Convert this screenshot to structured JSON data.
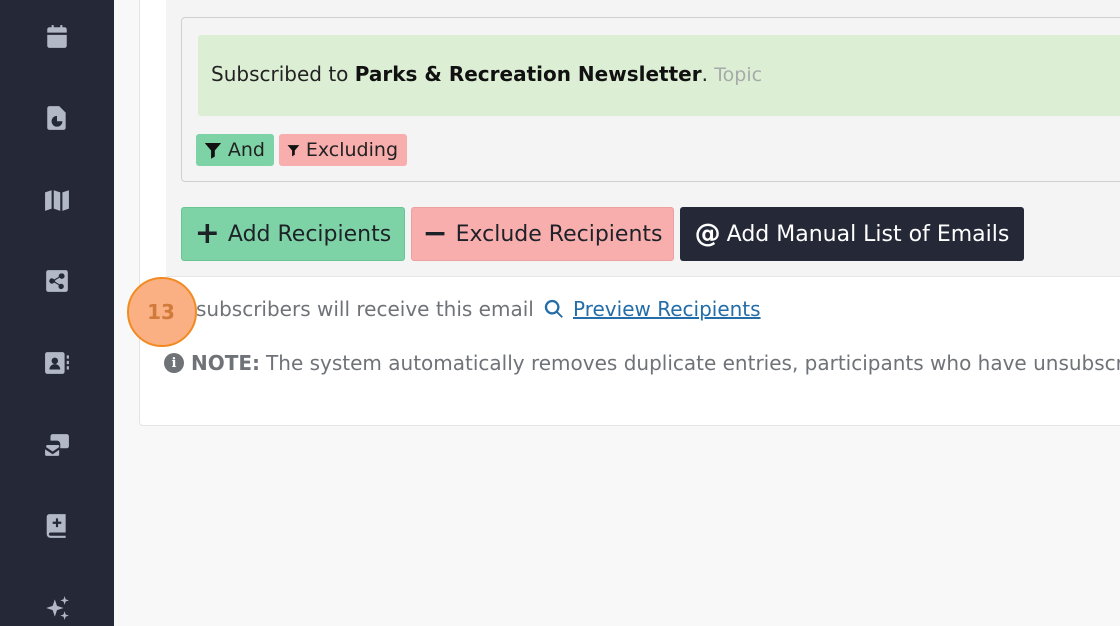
{
  "sidebar": {
    "icons": [
      "calendar-icon",
      "file-chart-icon",
      "map-icon",
      "share-icon",
      "contacts-icon",
      "mail-stack-icon",
      "book-plus-icon",
      "sparkles-icon"
    ]
  },
  "rule": {
    "prefix": "Subscribed to",
    "name": "Parks & Recreation Newsletter",
    "period": ".",
    "type": "Topic"
  },
  "chips": {
    "and": "And",
    "excluding": "Excluding"
  },
  "buttons": {
    "add": "Add Recipients",
    "add_glyph": "+",
    "exclude": "Exclude Recipients",
    "exclude_glyph": "−",
    "manual": "Add Manual List of Emails",
    "manual_glyph": "@"
  },
  "summary": {
    "count": "13",
    "text": "subscribers will receive this email",
    "preview_link": "Preview Recipients"
  },
  "note": {
    "label": "NOTE:",
    "text": "The system automatically removes duplicate entries, participants who have unsubscribed"
  },
  "colors": {
    "sidebar": "#252836",
    "green": "#7ed3a6",
    "red": "#f9aeae",
    "link": "#236da8",
    "highlight": "#fbb083"
  }
}
